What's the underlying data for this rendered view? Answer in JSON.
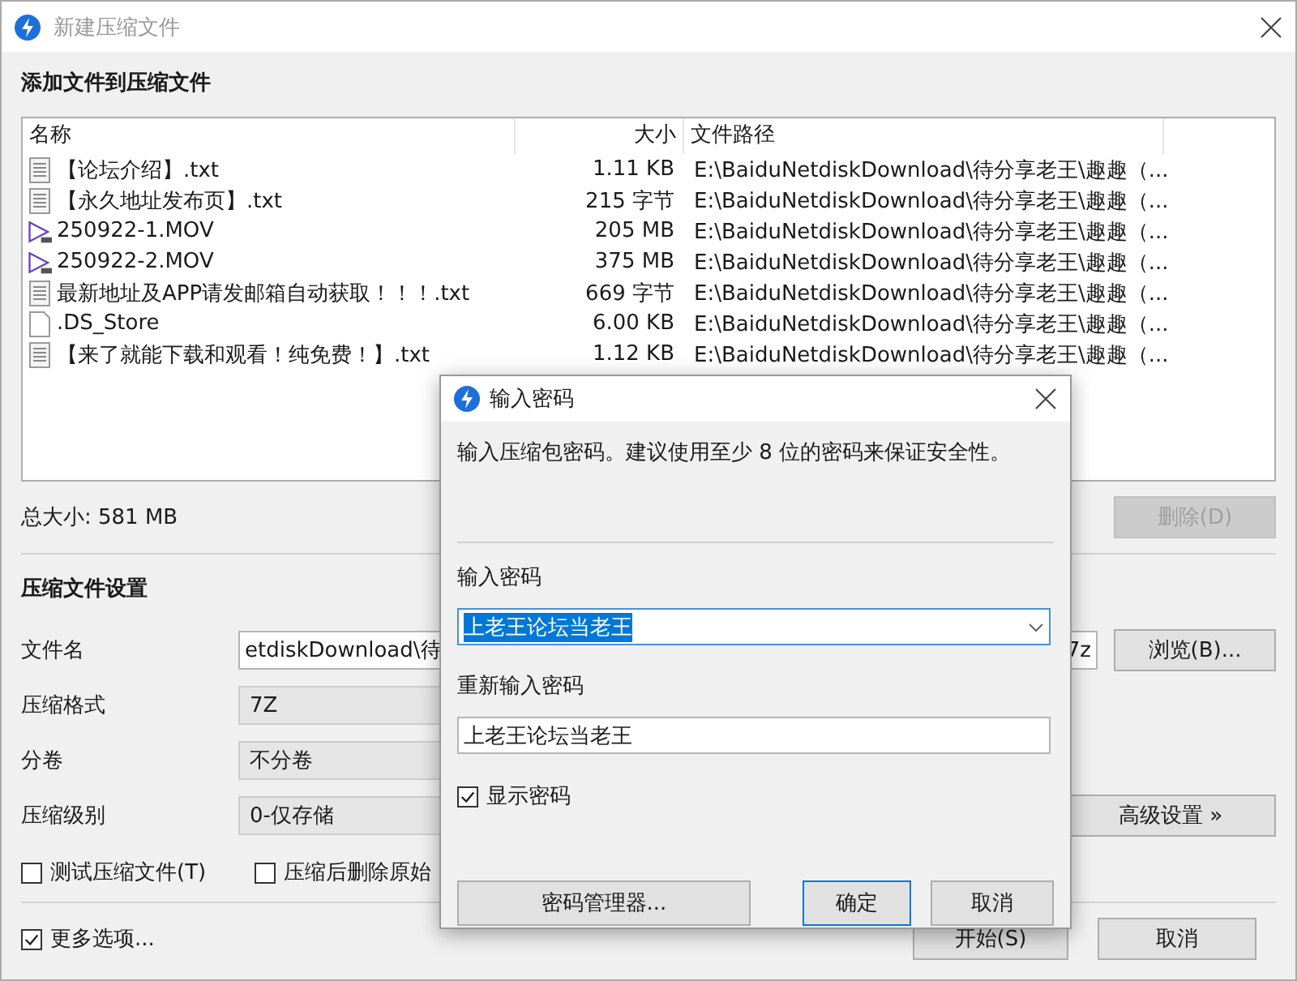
{
  "window": {
    "title": "新建压缩文件",
    "heading": "添加文件到压缩文件"
  },
  "file_list": {
    "columns": [
      "名称",
      "大小",
      "文件路径"
    ],
    "rows": [
      {
        "kind": "text",
        "name": "【论坛介绍】.txt",
        "size": "1.11 KB",
        "path": "E:\\BaiduNetdiskDownload\\待分享老王\\趣趣（..."
      },
      {
        "kind": "text",
        "name": "【永久地址发布页】.txt",
        "size": "215 字节",
        "path": "E:\\BaiduNetdiskDownload\\待分享老王\\趣趣（..."
      },
      {
        "kind": "video",
        "name": "250922-1.MOV",
        "size": "205 MB",
        "path": "E:\\BaiduNetdiskDownload\\待分享老王\\趣趣（..."
      },
      {
        "kind": "video",
        "name": "250922-2.MOV",
        "size": "375 MB",
        "path": "E:\\BaiduNetdiskDownload\\待分享老王\\趣趣（..."
      },
      {
        "kind": "text",
        "name": "最新地址及APP请发邮箱自动获取！！！.txt",
        "size": "669 字节",
        "path": "E:\\BaiduNetdiskDownload\\待分享老王\\趣趣（..."
      },
      {
        "kind": "blank",
        "name": ".DS_Store",
        "size": "6.00 KB",
        "path": "E:\\BaiduNetdiskDownload\\待分享老王\\趣趣（..."
      },
      {
        "kind": "text",
        "name": "【来了就能下载和观看！纯免费！】.txt",
        "size": "1.12 KB",
        "path": "E:\\BaiduNetdiskDownload\\待分享老王\\趣趣（..."
      }
    ]
  },
  "total_size": "总大小: 581 MB",
  "delete_button": {
    "label": "删除(D)",
    "disabled": true
  },
  "settings": {
    "heading": "压缩文件设置",
    "filename": {
      "label": "文件名",
      "value": "etdiskDownload\\待",
      "end": "7z"
    },
    "browse_button": "浏览(B)...",
    "format": {
      "label": "压缩格式",
      "value": "7Z"
    },
    "split": {
      "label": "分卷",
      "value": "不分卷"
    },
    "level": {
      "label": "压缩级别",
      "value": "0-仅存储"
    },
    "advanced_button": "高级设置 »",
    "options": [
      {
        "label": "测试压缩文件(T)",
        "checked": false
      },
      {
        "label": "压缩后删除原始",
        "checked": false
      }
    ]
  },
  "more_options": {
    "label": "更多选项...",
    "checked": true
  },
  "buttons": [
    {
      "label": "开始(S)"
    },
    {
      "label": "取消"
    }
  ],
  "password_dialog": {
    "title": "输入密码",
    "description": "输入压缩包密码。建议使用至少 8 位的密码来保证安全性。",
    "password": {
      "label": "输入密码",
      "value": "上老王论坛当老王",
      "selected": true
    },
    "repeat": {
      "label": "重新输入密码",
      "value": "上老王论坛当老王"
    },
    "show_password": {
      "label": "显示密码",
      "checked": true
    },
    "manager_button": "密码管理器...",
    "buttons": [
      {
        "label": "确定",
        "focused": true
      },
      {
        "label": "取消",
        "focused": false
      }
    ]
  }
}
